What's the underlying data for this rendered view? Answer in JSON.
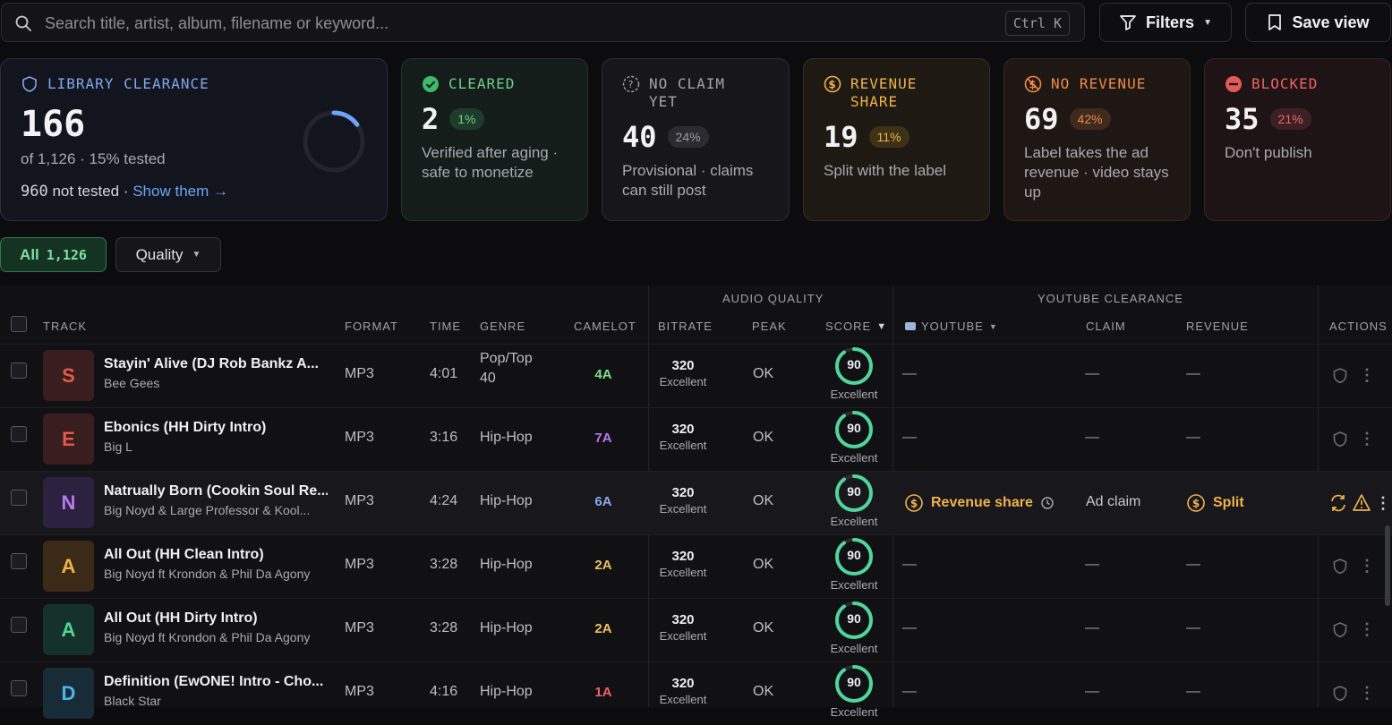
{
  "search": {
    "placeholder": "Search title, artist, album, filename or keyword...",
    "shortcut": "Ctrl K"
  },
  "toolbar": {
    "filters_label": "Filters",
    "save_label": "Save view"
  },
  "cards": {
    "library": {
      "title": "LIBRARY CLEARANCE",
      "value": "166",
      "sub": "of 1,126 · 15% tested",
      "not_tested_count": "960",
      "not_tested_text": " not tested · ",
      "link": "Show them →",
      "progress": 0.15
    },
    "cleared": {
      "title": "CLEARED",
      "value": "2",
      "pct": "1%",
      "desc": "Verified after aging · safe to monetize"
    },
    "no_claim": {
      "title": "NO CLAIM YET",
      "value": "40",
      "pct": "24%",
      "desc": "Provisional · claims can still post"
    },
    "revenue_share": {
      "title": "REVENUE SHARE",
      "value": "19",
      "pct": "11%",
      "desc": "Split with the label"
    },
    "no_revenue": {
      "title": "NO REVENUE",
      "value": "69",
      "pct": "42%",
      "desc": "Label takes the ad revenue · video stays up"
    },
    "blocked": {
      "title": "BLOCKED",
      "value": "35",
      "pct": "21%",
      "desc": "Don't publish"
    }
  },
  "chips": {
    "all_label": "All",
    "all_count": "1,126",
    "quality_label": "Quality"
  },
  "table": {
    "groups": {
      "audio_quality": "AUDIO QUALITY",
      "youtube_clearance": "YOUTUBE CLEARANCE"
    },
    "headers": {
      "track": "TRACK",
      "format": "FORMAT",
      "time": "TIME",
      "genre": "GENRE",
      "camelot": "CAMELOT",
      "bitrate": "BITRATE",
      "peak": "PEAK",
      "score": "SCORE",
      "youtube": "YOUTUBE",
      "claim": "CLAIM",
      "revenue": "REVENUE",
      "actions": "ACTIONS"
    },
    "rows": [
      {
        "letter": "S",
        "title": "Stayin' Alive (DJ Rob Bankz A...",
        "artist": "Bee Gees",
        "format": "MP3",
        "time": "4:01",
        "genre": "Pop/Top 40",
        "camelot": "4A",
        "bitrate": "320",
        "bitrate_label": "Excellent",
        "peak": "OK",
        "score": "90",
        "score_label": "Excellent",
        "youtube": "—",
        "claim": "—",
        "revenue": "—"
      },
      {
        "letter": "E",
        "title": "Ebonics (HH Dirty Intro)",
        "artist": "Big L",
        "format": "MP3",
        "time": "3:16",
        "genre": "Hip-Hop",
        "camelot": "7A",
        "bitrate": "320",
        "bitrate_label": "Excellent",
        "peak": "OK",
        "score": "90",
        "score_label": "Excellent",
        "youtube": "—",
        "claim": "—",
        "revenue": "—"
      },
      {
        "letter": "N",
        "title": "Natrually Born (Cookin Soul Re...",
        "artist": "Big Noyd & Large Professor & Kool...",
        "format": "MP3",
        "time": "4:24",
        "genre": "Hip-Hop",
        "camelot": "6A",
        "bitrate": "320",
        "bitrate_label": "Excellent",
        "peak": "OK",
        "score": "90",
        "score_label": "Excellent",
        "youtube": "Revenue share",
        "claim": "Ad claim",
        "revenue": "Split"
      },
      {
        "letter": "A",
        "title": "All Out (HH Clean Intro)",
        "artist": "Big Noyd ft Krondon & Phil Da Agony",
        "format": "MP3",
        "time": "3:28",
        "genre": "Hip-Hop",
        "camelot": "2A",
        "bitrate": "320",
        "bitrate_label": "Excellent",
        "peak": "OK",
        "score": "90",
        "score_label": "Excellent",
        "youtube": "—",
        "claim": "—",
        "revenue": "—"
      },
      {
        "letter": "A",
        "title": "All Out (HH Dirty Intro)",
        "artist": "Big Noyd ft Krondon & Phil Da Agony",
        "format": "MP3",
        "time": "3:28",
        "genre": "Hip-Hop",
        "camelot": "2A",
        "bitrate": "320",
        "bitrate_label": "Excellent",
        "peak": "OK",
        "score": "90",
        "score_label": "Excellent",
        "youtube": "—",
        "claim": "—",
        "revenue": "—"
      },
      {
        "letter": "D",
        "title": "Definition (EwONE! Intro - Cho...",
        "artist": "Black Star",
        "format": "MP3",
        "time": "4:16",
        "genre": "Hip-Hop",
        "camelot": "1A",
        "bitrate": "320",
        "bitrate_label": "Excellent",
        "peak": "OK",
        "score": "90",
        "score_label": "Excellent",
        "youtube": "—",
        "claim": "—",
        "revenue": "—"
      }
    ]
  },
  "colors": {
    "accent_blue": "#6ea4f5",
    "green": "#6fcf8a",
    "amber": "#f0b34a",
    "orange": "#f08a45",
    "red": "#f06060"
  }
}
